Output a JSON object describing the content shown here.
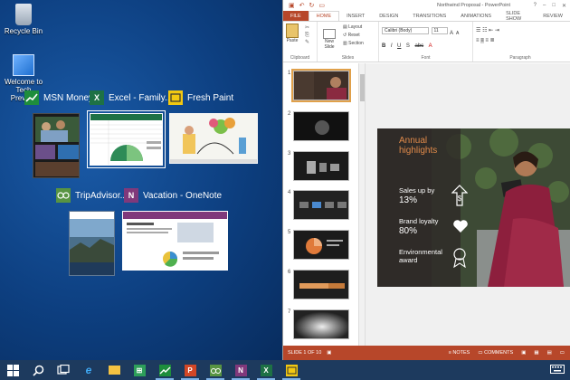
{
  "desktop": {
    "icons": [
      {
        "label": "Recycle Bin"
      },
      {
        "label": "Welcome to Tech Preview"
      }
    ]
  },
  "taskview": {
    "windows": [
      {
        "title": "MSN Money",
        "color": "#1e8d3c"
      },
      {
        "title": "Excel - Family...",
        "color": "#1e7145"
      },
      {
        "title": "Fresh Paint",
        "color": "#f2c811"
      },
      {
        "title": "TripAdvisor...",
        "color": "#589442"
      },
      {
        "title": "Vacation - OneNote",
        "color": "#80397b"
      }
    ]
  },
  "ppt": {
    "title": "Northwind Proposal - PowerPoint",
    "tabs": [
      "FILE",
      "HOME",
      "INSERT",
      "DESIGN",
      "TRANSITIONS",
      "ANIMATIONS",
      "SLIDE SHOW",
      "REVIEW"
    ],
    "ribbon": {
      "paste": "Paste",
      "new_slide": "New Slide",
      "layout": "Layout",
      "reset": "Reset",
      "section": "Section",
      "font_name": "Calibri (Body)",
      "font_size": "11",
      "groups": [
        "Clipboard",
        "Slides",
        "Font",
        "Paragraph"
      ]
    },
    "slide_numbers": [
      "1",
      "2",
      "3",
      "4",
      "5",
      "6",
      "7"
    ],
    "slide": {
      "heading": "Annual highlights",
      "stat1_label": "Sales up by",
      "stat1_value": "13%",
      "stat2_label": "Brand loyalty",
      "stat2_value": "80%",
      "stat3_label": "Environmental award"
    },
    "status": {
      "slide_of": "SLIDE 1 OF 10",
      "notes": "NOTES",
      "comments": "COMMENTS"
    },
    "accent": "#b7472a"
  },
  "taskbar": {
    "apps": [
      "start",
      "search",
      "task-view",
      "internet-explorer",
      "file-explorer",
      "store",
      "msn-money",
      "powerpoint",
      "tripadvisor",
      "onenote",
      "excel",
      "fresh-paint"
    ]
  }
}
